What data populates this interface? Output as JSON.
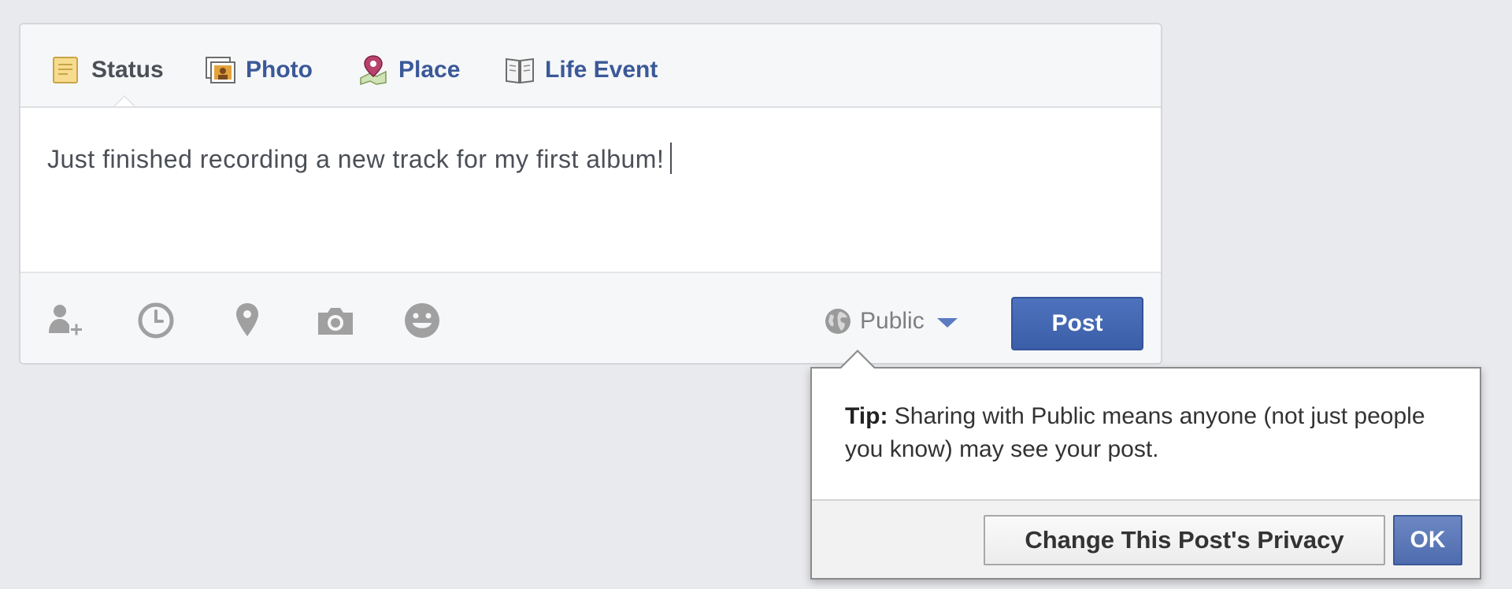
{
  "composer": {
    "tabs": [
      {
        "label": "Status",
        "icon": "note-icon",
        "active": true
      },
      {
        "label": "Photo",
        "icon": "photo-icon",
        "active": false
      },
      {
        "label": "Place",
        "icon": "map-pin-icon",
        "active": false
      },
      {
        "label": "Life Event",
        "icon": "book-icon",
        "active": false
      }
    ],
    "text": "Just finished recording a new track for my first album!",
    "footer_icons": [
      "tag-friends-icon",
      "clock-icon",
      "location-pin-icon",
      "camera-icon",
      "smiley-icon"
    ],
    "audience": {
      "label": "Public",
      "icon": "globe-icon"
    },
    "post_label": "Post"
  },
  "tip": {
    "prefix": "Tip:",
    "message": " Sharing with Public means anyone (not just people you know) may see your post.",
    "change_label": "Change This Post's Privacy",
    "ok_label": "OK"
  },
  "colors": {
    "background": "#e9eaed",
    "link_blue": "#3b5998",
    "button_blue": "#4267b2",
    "icon_gray": "#909090"
  }
}
